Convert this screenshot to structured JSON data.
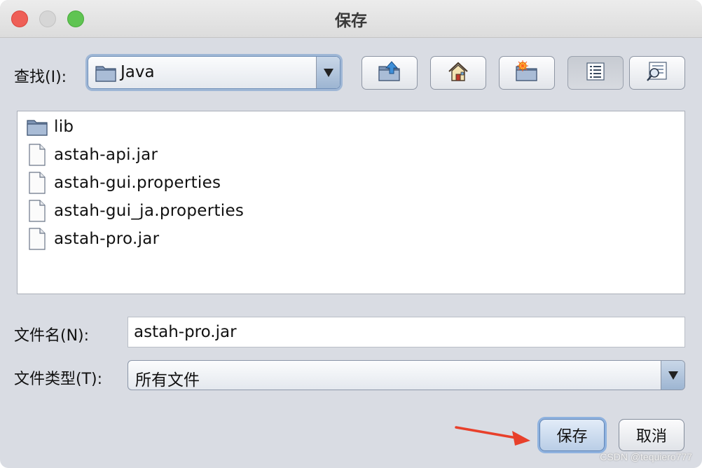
{
  "window": {
    "title": "保存"
  },
  "toolbar": {
    "lookin_label": "查找(I):",
    "lookin_value": "Java",
    "buttons": [
      {
        "name": "up-one-level",
        "icon": "folder-up-icon"
      },
      {
        "name": "home",
        "icon": "home-icon"
      },
      {
        "name": "new-folder",
        "icon": "new-folder-icon"
      },
      {
        "name": "list-view",
        "icon": "list-view-icon",
        "pressed": true
      },
      {
        "name": "details-view",
        "icon": "details-view-icon"
      }
    ]
  },
  "files": [
    {
      "name": "lib",
      "type": "folder"
    },
    {
      "name": "astah-api.jar",
      "type": "file"
    },
    {
      "name": "astah-gui.properties",
      "type": "file"
    },
    {
      "name": "astah-gui_ja.properties",
      "type": "file"
    },
    {
      "name": "astah-pro.jar",
      "type": "file"
    }
  ],
  "form": {
    "filename_label": "文件名(N):",
    "filename_value": "astah-pro.jar",
    "filetype_label": "文件类型(T):",
    "filetype_value": "所有文件"
  },
  "actions": {
    "save_label": "保存",
    "cancel_label": "取消"
  },
  "watermark": "CSDN @tequiero777",
  "colors": {
    "dialog_bg": "#d9dce3",
    "annotation_arrow": "#e8402b",
    "default_button": "#b9cde6"
  }
}
